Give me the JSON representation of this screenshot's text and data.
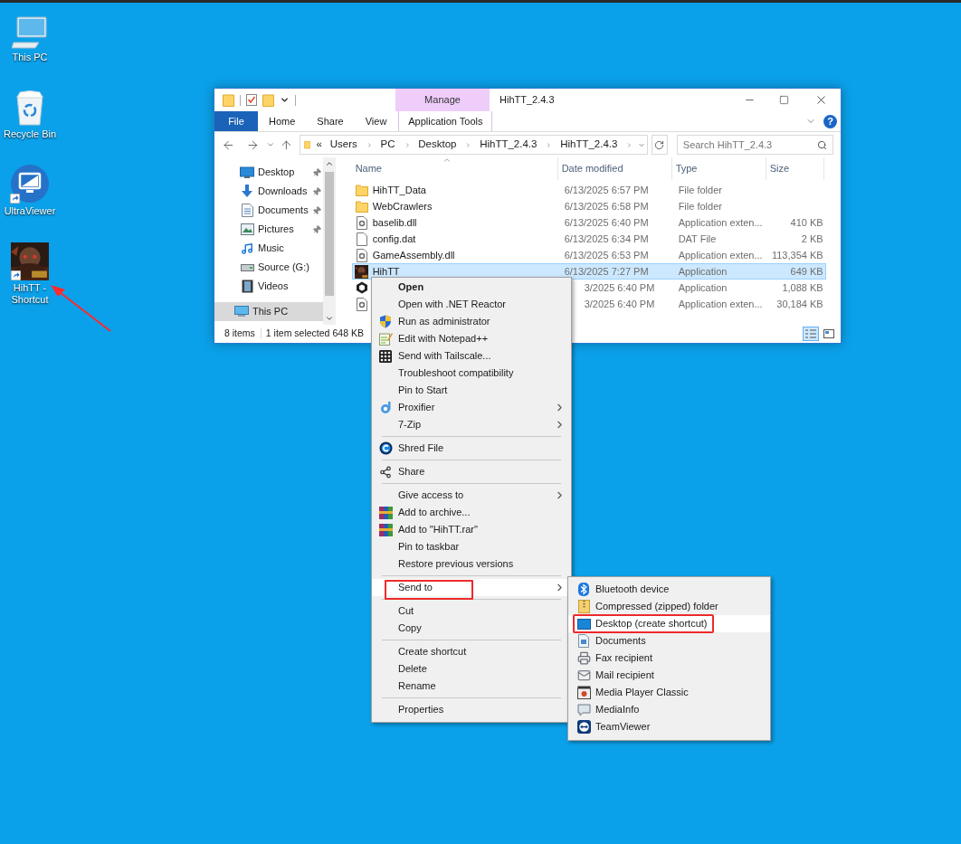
{
  "desktop_icons": [
    {
      "label": "This PC",
      "kind": "pc",
      "pointed": false
    },
    {
      "label": "Recycle Bin",
      "kind": "bin",
      "pointed": false
    },
    {
      "label": "UltraViewer",
      "kind": "ultraviewer",
      "pointed": false
    },
    {
      "label": "HihTT - Shortcut",
      "kind": "game",
      "pointed": true
    }
  ],
  "explorer": {
    "title": "HihTT_2.4.3",
    "contextual_group": "Manage",
    "help": "?",
    "tabs": [
      {
        "label": "File",
        "kind": "file"
      },
      {
        "label": "Home",
        "kind": "normal"
      },
      {
        "label": "Share",
        "kind": "normal"
      },
      {
        "label": "View",
        "kind": "normal"
      },
      {
        "label": "Application Tools",
        "kind": "contextual"
      }
    ],
    "address": {
      "overflow": "«",
      "segments": [
        "Users",
        "PC",
        "Desktop",
        "HihTT_2.4.3",
        "HihTT_2.4.3"
      ]
    },
    "search": {
      "placeholder": "Search HihTT_2.4.3"
    },
    "nav_pane": [
      {
        "label": "Desktop",
        "kind": "desktop",
        "pinned": true,
        "selected": false
      },
      {
        "label": "Downloads",
        "kind": "downloads",
        "pinned": true,
        "selected": false
      },
      {
        "label": "Documents",
        "kind": "documents",
        "pinned": true,
        "selected": false
      },
      {
        "label": "Pictures",
        "kind": "pictures",
        "pinned": true,
        "selected": false
      },
      {
        "label": "Music",
        "kind": "music",
        "pinned": false,
        "selected": false
      },
      {
        "label": "Source (G:)",
        "kind": "drive",
        "pinned": false,
        "selected": false
      },
      {
        "label": "Videos",
        "kind": "videos",
        "pinned": false,
        "selected": false
      },
      {
        "label": "This PC",
        "kind": "pc",
        "pinned": false,
        "selected": true
      }
    ],
    "columns": [
      "Name",
      "Date modified",
      "Type",
      "Size"
    ],
    "rows": [
      {
        "kind": "folder",
        "name": "HihTT_Data",
        "date": "6/13/2025 6:57 PM",
        "type": "File folder",
        "selected": false
      },
      {
        "kind": "folder",
        "name": "WebCrawlers",
        "date": "6/13/2025 6:58 PM",
        "type": "File folder",
        "selected": false
      },
      {
        "kind": "dll",
        "name": "baselib.dll",
        "date": "6/13/2025 6:40 PM",
        "type": "Application exten...",
        "size": "410 KB",
        "selected": false
      },
      {
        "kind": "file",
        "name": "config.dat",
        "date": "6/13/2025 6:34 PM",
        "type": "DAT File",
        "size": "2 KB",
        "selected": false
      },
      {
        "kind": "dll",
        "name": "GameAssembly.dll",
        "date": "6/13/2025 6:53 PM",
        "type": "Application exten...",
        "size": "113,354 KB",
        "selected": false
      },
      {
        "kind": "game",
        "name": "HihTT",
        "date": "6/13/2025 7:27 PM",
        "type": "Application",
        "size": "649 KB",
        "selected": true
      },
      {
        "kind": "unity",
        "date": "3/2025 6:40 PM",
        "type": "Application",
        "size": "1,088 KB",
        "selected": false
      },
      {
        "kind": "dll",
        "date": "3/2025 6:40 PM",
        "type": "Application exten...",
        "size": "30,184 KB",
        "selected": false
      }
    ],
    "status": {
      "count": "8 items",
      "selection": "1 item selected",
      "selection_size": "648 KB"
    },
    "views": [
      {
        "kind": "details",
        "selected": true
      },
      {
        "kind": "tiles",
        "selected": false
      }
    ]
  },
  "context_menu": {
    "groups": [
      {
        "items": [
          {
            "label": "Open",
            "kind": "plain",
            "bold": true
          },
          {
            "label": "Open with .NET Reactor",
            "kind": "plain"
          },
          {
            "label": "Run as administrator",
            "kind": "shield"
          },
          {
            "label": "Edit with Notepad++",
            "kind": "notepad"
          },
          {
            "label": "Send with Tailscale...",
            "kind": "tailscale"
          },
          {
            "label": "Troubleshoot compatibility",
            "kind": "plain"
          },
          {
            "label": "Pin to Start",
            "kind": "plain"
          },
          {
            "label": "Proxifier",
            "kind": "proxifier",
            "submenu": true
          },
          {
            "label": "7-Zip",
            "kind": "plain",
            "submenu": true
          }
        ]
      },
      {
        "items": [
          {
            "label": "Shred File",
            "kind": "shred"
          }
        ]
      },
      {
        "items": [
          {
            "label": "Share",
            "kind": "share"
          }
        ]
      },
      {
        "items": [
          {
            "label": "Give access to",
            "kind": "plain",
            "submenu": true
          },
          {
            "label": "Add to archive...",
            "kind": "winrar"
          },
          {
            "label": "Add to \"HihTT.rar\"",
            "kind": "winrar"
          },
          {
            "label": "Pin to taskbar",
            "kind": "plain"
          },
          {
            "label": "Restore previous versions",
            "kind": "plain"
          }
        ]
      },
      {
        "items": [
          {
            "label": "Send to",
            "kind": "plain",
            "submenu": true,
            "highlighted": true,
            "annotated": true
          }
        ]
      },
      {
        "items": [
          {
            "label": "Cut",
            "kind": "plain"
          },
          {
            "label": "Copy",
            "kind": "plain"
          }
        ]
      },
      {
        "items": [
          {
            "label": "Create shortcut",
            "kind": "plain"
          },
          {
            "label": "Delete",
            "kind": "plain"
          },
          {
            "label": "Rename",
            "kind": "plain"
          }
        ]
      },
      {
        "items": [
          {
            "label": "Properties",
            "kind": "plain"
          }
        ]
      }
    ]
  },
  "send_to_menu": [
    {
      "label": "Bluetooth device",
      "kind": "bluetooth",
      "highlighted": false,
      "annotated": false
    },
    {
      "label": "Compressed (zipped) folder",
      "kind": "zip",
      "highlighted": false,
      "annotated": false
    },
    {
      "label": "Desktop (create shortcut)",
      "kind": "desktop",
      "highlighted": true,
      "annotated": true
    },
    {
      "label": "Documents",
      "kind": "documents",
      "highlighted": false,
      "annotated": false
    },
    {
      "label": "Fax recipient",
      "kind": "fax",
      "highlighted": false,
      "annotated": false
    },
    {
      "label": "Mail recipient",
      "kind": "mail",
      "highlighted": false,
      "annotated": false
    },
    {
      "label": "Media Player Classic",
      "kind": "mpc",
      "highlighted": false,
      "annotated": false
    },
    {
      "label": "MediaInfo",
      "kind": "mediainfo",
      "highlighted": false,
      "annotated": false
    },
    {
      "label": "TeamViewer",
      "kind": "teamviewer",
      "highlighted": false,
      "annotated": false
    }
  ]
}
